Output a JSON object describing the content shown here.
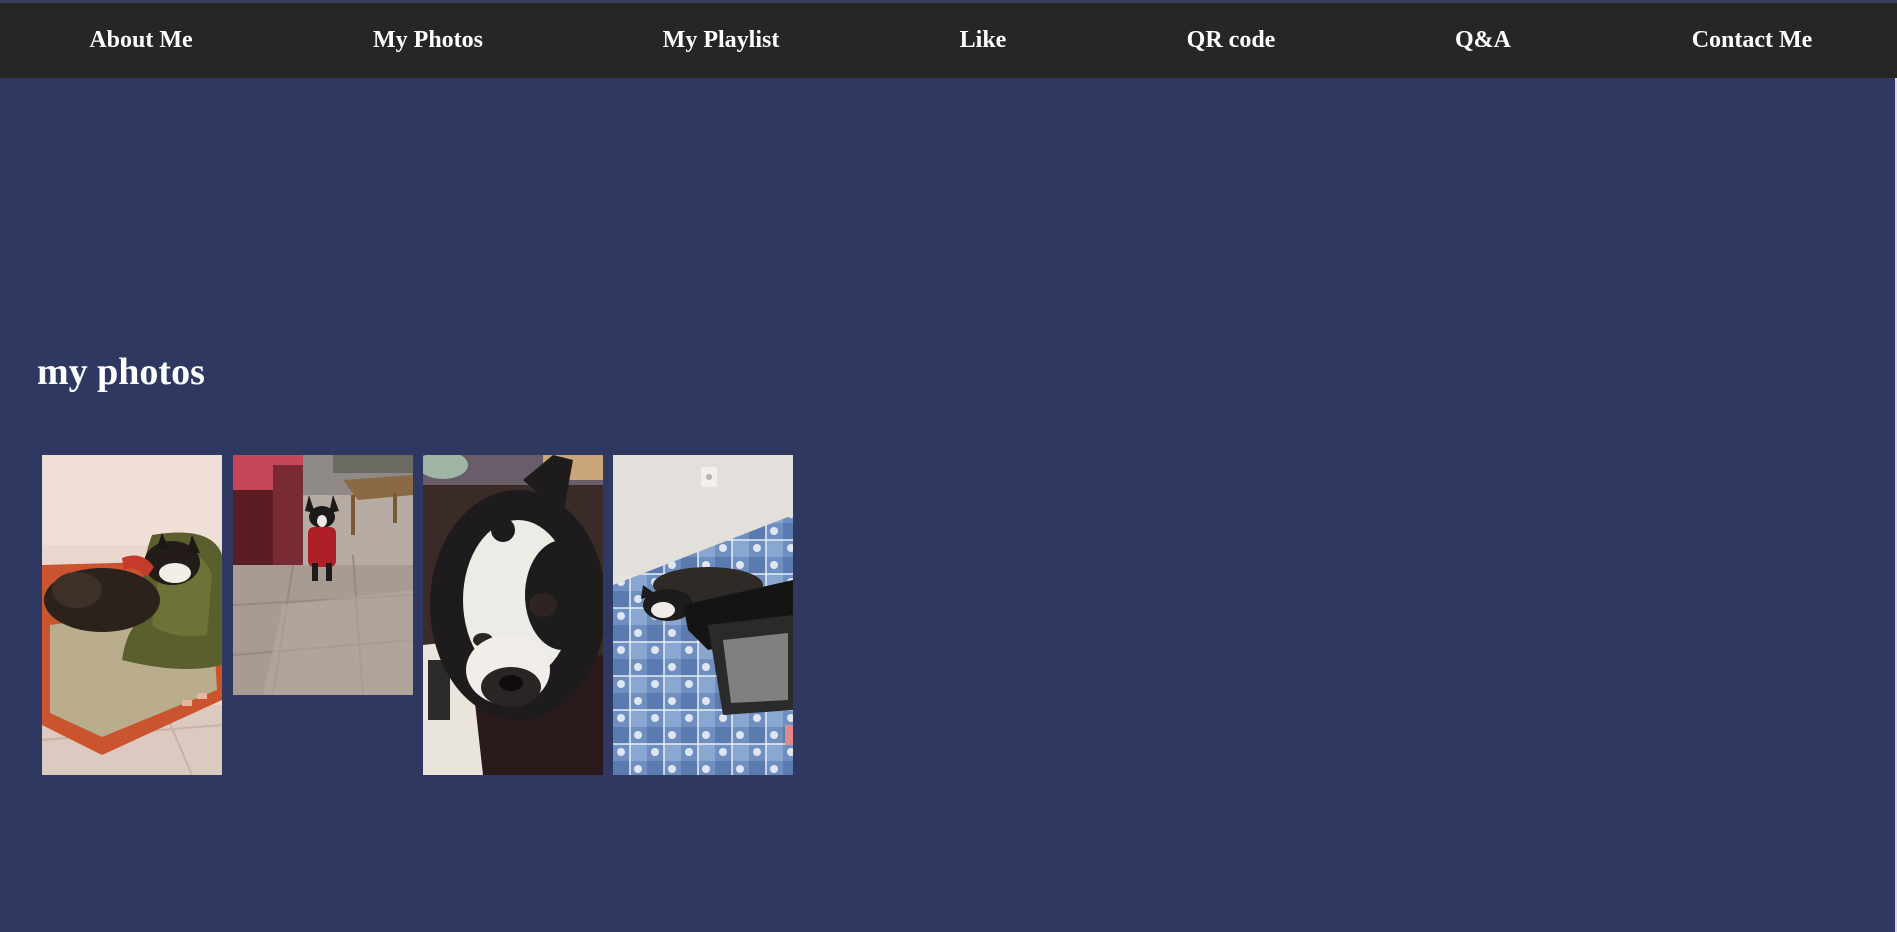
{
  "nav": {
    "items": [
      {
        "label": "About Me"
      },
      {
        "label": "My Photos"
      },
      {
        "label": "My Playlist"
      },
      {
        "label": "Like"
      },
      {
        "label": "QR code"
      },
      {
        "label": "Q&A"
      },
      {
        "label": "Contact Me"
      }
    ]
  },
  "main": {
    "title": "my photos",
    "photos": [
      {
        "subject": "dog sleeping on cushion in a basket"
      },
      {
        "subject": "dog in red sweater standing on tile floor"
      },
      {
        "subject": "close-up of dog face"
      },
      {
        "subject": "dog lying on blue patterned bedspread"
      }
    ]
  },
  "colors": {
    "background": "#2e3860",
    "navbar": "#282624",
    "text": "#ffffff"
  }
}
